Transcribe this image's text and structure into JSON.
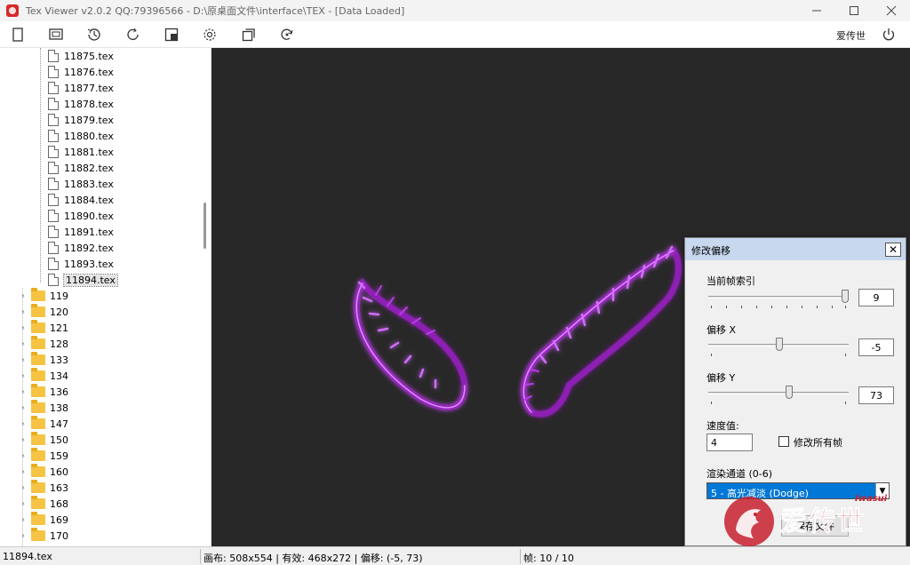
{
  "window": {
    "title": "Tex Viewer v2.0.2 QQ:79396566 - D:\\原桌面文件\\interface\\TEX - [Data Loaded]",
    "controls": [
      "minimize-icon",
      "maximize-icon",
      "close-icon"
    ]
  },
  "toolbar": {
    "icons": [
      "new-file-icon",
      "slideshow-icon",
      "history-icon",
      "refresh-icon",
      "frame-icon",
      "settings-icon",
      "copy-icon",
      "rotate-icon"
    ],
    "user": "爱传世",
    "power_icon": "power-icon"
  },
  "tree": {
    "files": [
      "11875.tex",
      "11876.tex",
      "11877.tex",
      "11878.tex",
      "11879.tex",
      "11880.tex",
      "11881.tex",
      "11882.tex",
      "11883.tex",
      "11884.tex",
      "11890.tex",
      "11891.tex",
      "11892.tex",
      "11893.tex",
      "11894.tex"
    ],
    "selected_file": "11894.tex",
    "folders": [
      "119",
      "120",
      "121",
      "128",
      "133",
      "134",
      "136",
      "138",
      "147",
      "150",
      "159",
      "160",
      "163",
      "168",
      "169",
      "170"
    ]
  },
  "status": {
    "file": "11894.tex",
    "info": "画布: 508x554 | 有效: 468x272 | 偏移: (-5, 73)",
    "frame": "帧: 10 / 10"
  },
  "dialog": {
    "title": "修改偏移",
    "frame_index_label": "当前帧索引",
    "frame_index_value": "9",
    "frame_index_max": 9,
    "offset_x_label": "偏移 X",
    "offset_x_value": "-5",
    "offset_y_label": "偏移 Y",
    "offset_y_value": "73",
    "speed_label": "速度值:",
    "speed_value": "4",
    "modify_all_label": "修改所有帧",
    "modify_all_checked": false,
    "render_channel_label": "渲染通道 (0-6)",
    "render_channel_value": "5 - 高光减淡 (Dodge)",
    "save_button": "保存文件"
  },
  "watermark": {
    "text": "爱传世",
    "small": "Iwasui"
  },
  "colors": {
    "canvas_bg": "#282828",
    "wing_glow": "#b020d8",
    "select_bg": "#0078d7",
    "dialog_title_bg": "#c7d8ef"
  }
}
